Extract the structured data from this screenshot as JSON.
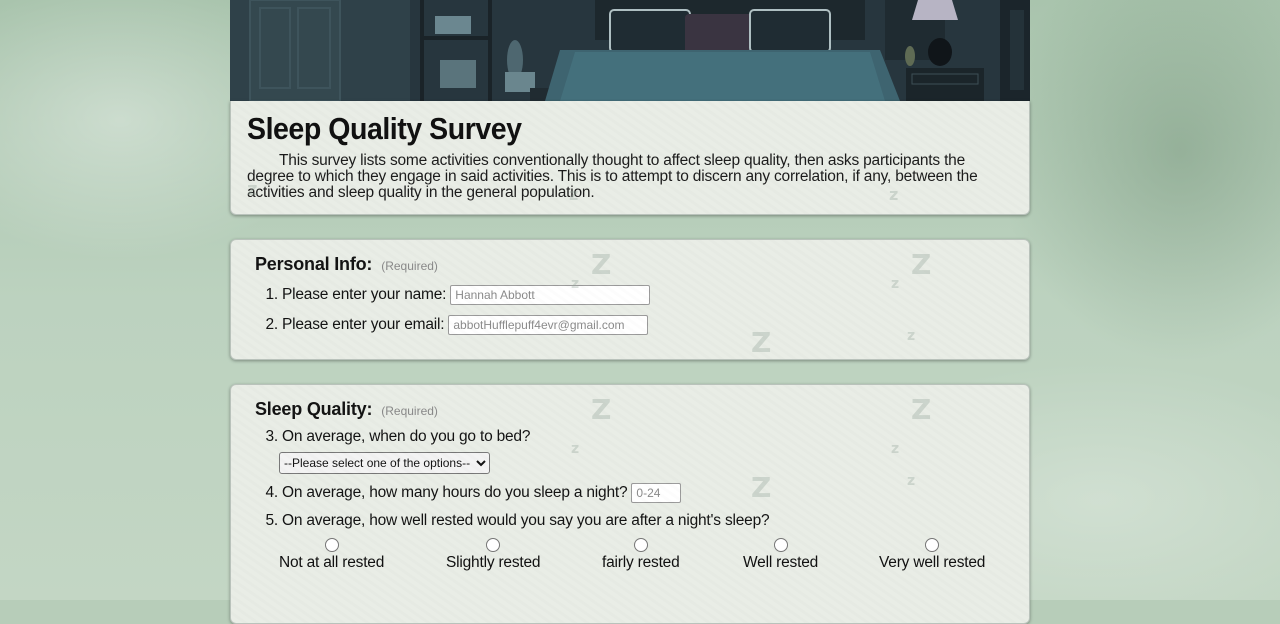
{
  "survey": {
    "title": "Sleep Quality Survey",
    "intro": "This survey lists some activities conventionally thought to affect sleep quality, then asks participants the degree to which they engage in said activities. This is to attempt to discern any correlation, if any, between the activities and sleep quality in the general population."
  },
  "personal": {
    "title": "Personal Info:",
    "required": "(Required)",
    "q1": {
      "num": "1.",
      "label": "Please enter your name:",
      "placeholder": "Hannah Abbott"
    },
    "q2": {
      "num": "2.",
      "label": "Please enter your email:",
      "placeholder": "abbotHufflepuff4evr@gmail.com"
    }
  },
  "sleep": {
    "title": "Sleep Quality:",
    "required": "(Required)",
    "q3": {
      "num": "3.",
      "label": "On average, when do you go to bed?",
      "selected": "--Please select one of the options--"
    },
    "q4": {
      "num": "4.",
      "label": "On average, how many hours do you sleep a night?",
      "placeholder": "0-24"
    },
    "q5": {
      "num": "5.",
      "label": "On average, how well rested would you say you are after a night's sleep?",
      "options": [
        "Not at all rested",
        "Slightly rested",
        "fairly rested",
        "Well rested",
        "Very well rested"
      ]
    }
  },
  "colors": {
    "background": "#b7cdb9",
    "card": "#e9ede6",
    "hero": "#2b3b44"
  }
}
